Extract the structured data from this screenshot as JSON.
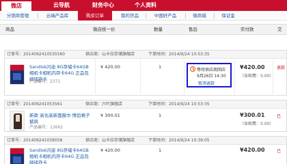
{
  "topnav": {
    "tabs": [
      {
        "label": "微店",
        "active": true
      },
      {
        "label": "云导航",
        "active": false
      },
      {
        "label": "财务中心",
        "active": false
      },
      {
        "label": "个人资料",
        "active": false
      }
    ]
  },
  "subnav": {
    "items": [
      {
        "label": "分销商管理",
        "active": false
      },
      {
        "label": "云端产品库",
        "active": false
      },
      {
        "label": "购买订单",
        "active": true
      },
      {
        "label": "我的货品",
        "active": false
      },
      {
        "label": "中国好产品",
        "active": false
      },
      {
        "label": "微商城",
        "active": false
      },
      {
        "label": "保证金",
        "active": false
      }
    ]
  },
  "table": {
    "headers": [
      "商品",
      "微店统一价",
      "数量",
      "售后",
      "实付款",
      "交"
    ]
  },
  "orders": [
    {
      "order_no": "订单号：20140924105355​60",
      "supplier": "供应商：山卡拉存储旗舰店",
      "order_time": "下单时间：2014/9/24 10:53:35",
      "product_name": "Sandisk闪迪 8G存储卡64GB 相机卡相机内存卡64G 正品包邮储存卡",
      "product_no": "产品编号：2371",
      "price": "¥ 420.00",
      "qty": "1",
      "paid": "¥420.00",
      "freight": "（含邮费：0.00）",
      "status": "退款",
      "aftersale": {
        "line1": "等待供应商回应",
        "line2": "9月26日 14:30",
        "link": "取消退款"
      }
    },
    {
      "order_no": "订单号：201409241053561",
      "supplier": "供应商：六叶旗舰店",
      "order_time": "下单时间：2014/9/24 10:53:35",
      "product_name": "新款 高化高新面服巾 情侣格子披肩",
      "product_no": "产品编号：12662",
      "price": "¥ 300.01",
      "qty": "1",
      "paid": "¥300.01",
      "freight": "（含邮费：0.00）",
      "status": "已"
    },
    {
      "order_no": "订单号：20140924103905​8",
      "supplier": "供应商：山卡拉存储旗舰店",
      "order_time": "下单时间：2014/9/24 10:39:05",
      "product_name": "Sandisk闪迪 8G存储卡64GB 相机卡相机内存卡64G 正品包邮储存卡",
      "product_no": "",
      "price": "¥ 420.00",
      "qty": "1",
      "paid": "¥420.00",
      "freight": "",
      "status": "已"
    }
  ]
}
